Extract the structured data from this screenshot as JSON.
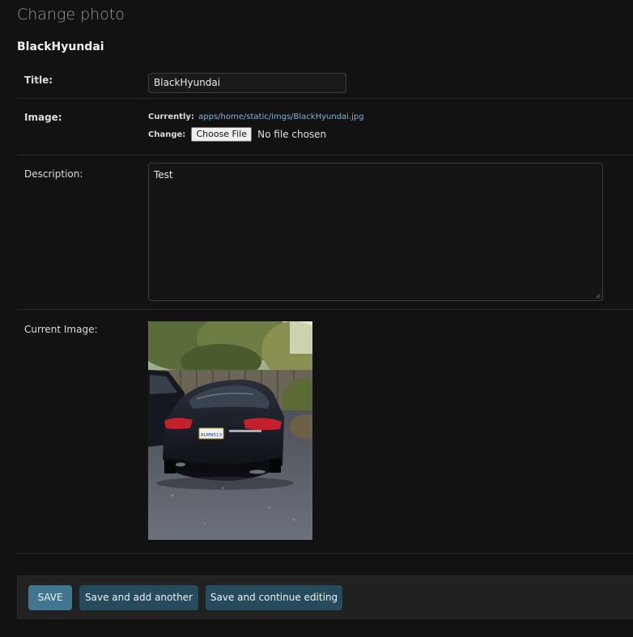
{
  "page_title": "Change photo",
  "object_name": "BlackHyundai",
  "fields": {
    "title": {
      "label": "Title:",
      "value": "BlackHyundai"
    },
    "image": {
      "label": "Image:",
      "currently_label": "Currently:",
      "current_path": "apps/home/static/imgs/BlackHyundai.jpg",
      "change_label": "Change:",
      "choose_button": "Choose File",
      "no_file_text": "No file chosen"
    },
    "description": {
      "label": "Description:",
      "value": "Test"
    },
    "current_image": {
      "label": "Current Image:",
      "plate_text": "8LMN513"
    }
  },
  "buttons": {
    "save": "SAVE",
    "save_add_another": "Save and add another",
    "save_continue": "Save and continue editing"
  },
  "colors": {
    "background": "#121212",
    "primary_button": "#417690",
    "secondary_button": "#264b5d",
    "link": "#7fb3d5"
  }
}
